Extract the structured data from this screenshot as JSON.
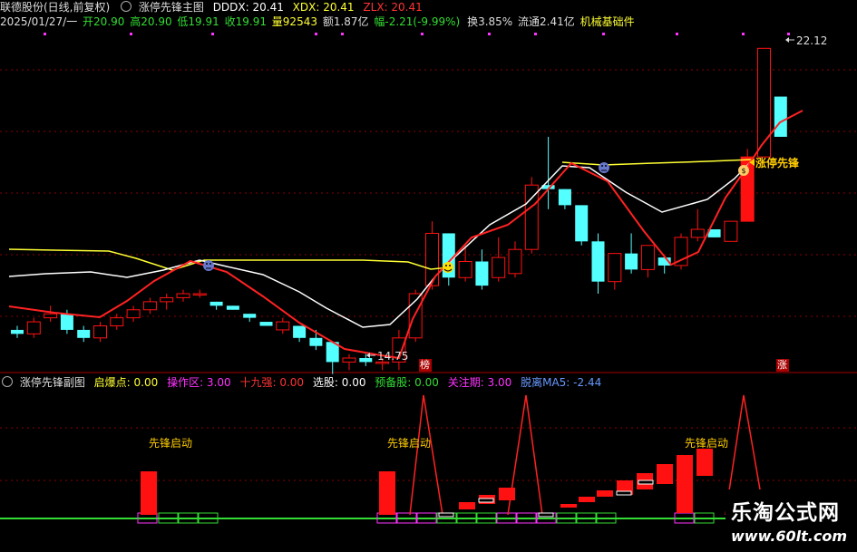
{
  "header": {
    "stock_name": "联德股份(日线,前复权)",
    "indicator_name": "涨停先锋主图",
    "dddx": "DDDX: 20.41",
    "xdx": "XDX: 20.41",
    "zlx": "ZLX: 20.41"
  },
  "quote": {
    "date": "2025/01/27/一",
    "open": "开20.90",
    "high": "高20.90",
    "low": "低19.91",
    "close": "收19.91",
    "volume": "量92543",
    "amount": "额1.87亿",
    "change": "幅-2.21(-9.99%)",
    "turnover": "换3.85%",
    "float_cap": "流通2.41亿",
    "sector": "机械基础件"
  },
  "main_chart": {
    "high_label": "22.12",
    "low_label": "14.75",
    "signal_label": "涨停先锋",
    "marker_bang": "榜",
    "marker_zhang": "涨"
  },
  "sub_header": {
    "name": "涨停先锋副图",
    "qibao": "启爆点: 0.00",
    "caozuo": "操作区: 3.00",
    "shijiu": "十九强: 0.00",
    "xuangu": "选股: 0.00",
    "yubei": "预备股: 0.00",
    "guanzhu": "关注期: 3.00",
    "tuoli": "脱离MA5: -2.44"
  },
  "sub_chart": {
    "start_label": "先锋启动"
  },
  "watermark": {
    "name": "乐淘公式网",
    "url": "www.60lt.com"
  },
  "colors": {
    "up": "#ff1111",
    "down": "#54ffff",
    "yellow": "#ffff33",
    "white": "#ffffff",
    "red_line": "#ff2222",
    "magenta": "#ff33ff",
    "green": "#33dd33",
    "label_gold": "#ffcc00"
  },
  "chart_data": {
    "type": "candlestick",
    "candles": [
      [
        15.1,
        15.2,
        14.9,
        15.0
      ],
      [
        15.0,
        15.4,
        14.9,
        15.3
      ],
      [
        15.4,
        15.7,
        15.3,
        15.5
      ],
      [
        15.5,
        15.6,
        15.0,
        15.1
      ],
      [
        15.1,
        15.2,
        14.8,
        14.9
      ],
      [
        14.9,
        15.3,
        14.8,
        15.2
      ],
      [
        15.2,
        15.5,
        15.1,
        15.4
      ],
      [
        15.4,
        15.7,
        15.3,
        15.6
      ],
      [
        15.6,
        15.9,
        15.5,
        15.8
      ],
      [
        15.8,
        16.0,
        15.6,
        15.9
      ],
      [
        15.9,
        16.1,
        15.8,
        16.0
      ],
      [
        16.0,
        16.1,
        15.9,
        16.0
      ],
      [
        15.8,
        15.8,
        15.6,
        15.7
      ],
      [
        15.7,
        15.7,
        15.6,
        15.6
      ],
      [
        15.5,
        15.5,
        15.3,
        15.4
      ],
      [
        15.3,
        15.3,
        15.2,
        15.2
      ],
      [
        15.1,
        15.4,
        15.0,
        15.3
      ],
      [
        15.2,
        15.2,
        14.8,
        14.9
      ],
      [
        14.9,
        15.1,
        14.6,
        14.7
      ],
      [
        14.8,
        14.8,
        14.0,
        14.3
      ],
      [
        14.3,
        14.5,
        14.1,
        14.4
      ],
      [
        14.4,
        14.5,
        14.2,
        14.3
      ],
      [
        14.3,
        14.4,
        14.1,
        14.3
      ],
      [
        14.3,
        15.1,
        14.1,
        14.9
      ],
      [
        14.9,
        16.1,
        14.8,
        16.0
      ],
      [
        16.2,
        17.8,
        16.1,
        17.5
      ],
      [
        17.5,
        17.5,
        16.2,
        16.4
      ],
      [
        16.4,
        17.2,
        16.3,
        16.8
      ],
      [
        16.8,
        17.1,
        16.1,
        16.2
      ],
      [
        16.4,
        17.4,
        16.3,
        16.9
      ],
      [
        16.5,
        17.3,
        16.4,
        17.1
      ],
      [
        17.1,
        18.9,
        17.0,
        18.7
      ],
      [
        18.7,
        19.9,
        18.1,
        18.6
      ],
      [
        18.6,
        18.6,
        18.1,
        18.2
      ],
      [
        18.2,
        18.2,
        17.2,
        17.3
      ],
      [
        17.3,
        17.5,
        16.0,
        16.3
      ],
      [
        16.3,
        17.0,
        16.1,
        17.0
      ],
      [
        17.0,
        17.5,
        16.5,
        16.6
      ],
      [
        16.6,
        17.2,
        16.4,
        17.2
      ],
      [
        16.9,
        16.9,
        16.5,
        16.7
      ],
      [
        16.7,
        17.5,
        16.6,
        17.4
      ],
      [
        17.4,
        18.1,
        17.3,
        17.6
      ],
      [
        17.6,
        17.6,
        17.4,
        17.4
      ],
      [
        17.3,
        17.3,
        17.5,
        17.8
      ],
      [
        17.8,
        19.6,
        17.8,
        19.4
      ],
      [
        19.4,
        22.1,
        19.4,
        22.1
      ],
      [
        20.9,
        20.9,
        19.9,
        19.9
      ]
    ]
  }
}
